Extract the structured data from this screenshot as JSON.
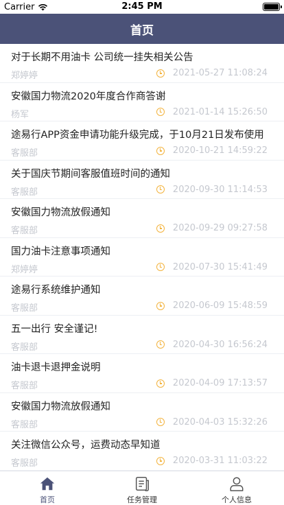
{
  "status_bar": {
    "carrier": "Carrier",
    "time": "2:45 PM"
  },
  "header": {
    "title": "首页"
  },
  "announcements": [
    {
      "title": "对于长期不用油卡 公司统一挂失相关公告",
      "author": "郑婷婷",
      "time": "2021-05-27 11:08:24"
    },
    {
      "title": "安徽国力物流2020年度合作商答谢",
      "author": "杨军",
      "time": "2021-01-14 15:26:50"
    },
    {
      "title": "途易行APP资金申请功能升级完成，于10月21日发布使用",
      "author": "客服部",
      "time": "2020-10-21 14:59:22"
    },
    {
      "title": "关于国庆节期间客服值班时间的通知",
      "author": "客服部",
      "time": "2020-09-30 11:14:53"
    },
    {
      "title": "安徽国力物流放假通知",
      "author": "客服部",
      "time": "2020-09-29 09:27:58"
    },
    {
      "title": "国力油卡注意事项通知",
      "author": "郑婷婷",
      "time": "2020-07-30 15:41:49"
    },
    {
      "title": "途易行系统维护通知",
      "author": "客服部",
      "time": "2020-06-09 15:48:59"
    },
    {
      "title": "五一出行 安全谨记!",
      "author": "客服部",
      "time": "2020-04-30 16:56:24"
    },
    {
      "title": "油卡退卡退押金说明",
      "author": "客服部",
      "time": "2020-04-09 17:13:57"
    },
    {
      "title": "安徽国力物流放假通知",
      "author": "客服部",
      "time": "2020-04-03 15:32:26"
    },
    {
      "title": "关注微信公众号，运费动态早知道",
      "author": "客服部",
      "time": "2020-03-31 11:03:22"
    }
  ],
  "tabbar": {
    "tabs": [
      {
        "label": "首页",
        "icon": "home-icon",
        "active": true
      },
      {
        "label": "任务管理",
        "icon": "document-icon",
        "active": false
      },
      {
        "label": "个人信息",
        "icon": "person-icon",
        "active": false
      }
    ]
  },
  "colors": {
    "header_bg": "#4b5278",
    "clock_icon": "#f3b33d",
    "meta_text": "#c5c8cf"
  }
}
